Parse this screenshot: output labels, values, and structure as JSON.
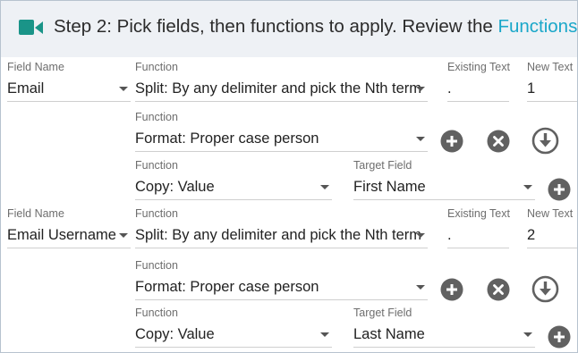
{
  "header": {
    "title": "Step 2: Pick fields, then functions to apply. Review the ",
    "link": "Functions G",
    "icon": "video-camera-icon",
    "accent_color": "#1aa7c9",
    "icon_color": "#1a9488"
  },
  "labels": {
    "field_name": "Field Name",
    "function": "Function",
    "existing_text": "Existing Text",
    "new_text": "New Text",
    "target_field": "Target Field"
  },
  "group1": {
    "field_name": "Email",
    "split_function": "Split: By any delimiter and pick the Nth term",
    "existing_text": ".",
    "new_text": "1",
    "format_function": "Format: Proper case person",
    "copy_function": "Copy: Value",
    "target_field": "First Name"
  },
  "group2": {
    "field_name": "Email Username",
    "split_function": "Split: By any delimiter and pick the Nth term",
    "existing_text": ".",
    "new_text": "2",
    "format_function": "Format: Proper case person",
    "copy_function": "Copy: Value",
    "target_field": "Last Name"
  }
}
